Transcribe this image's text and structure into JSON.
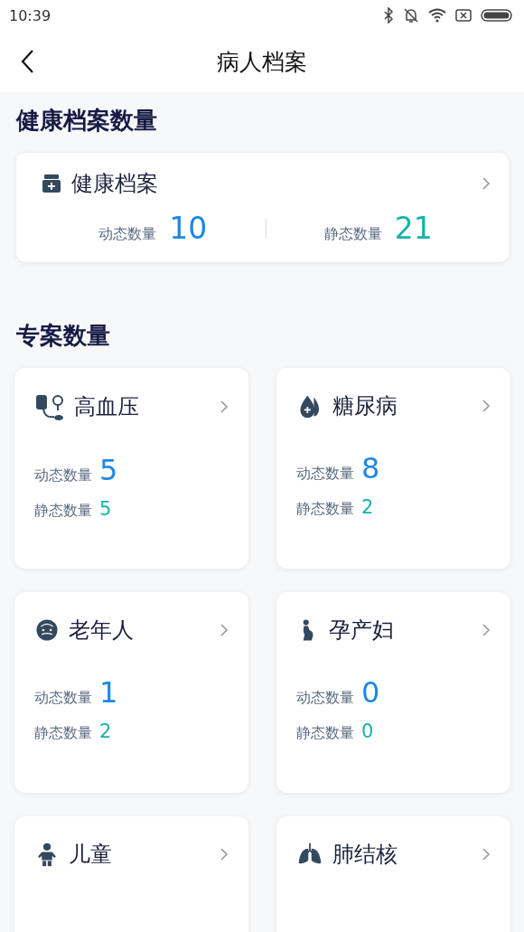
{
  "status_bar": {
    "time": "10:39"
  },
  "header": {
    "title": "病人档案"
  },
  "health_section": {
    "title": "健康档案数量",
    "card": {
      "title": "健康档案",
      "dynamic_label": "动态数量",
      "dynamic_count": "10",
      "static_label": "静态数量",
      "static_count": "21"
    }
  },
  "project_section": {
    "title": "专案数量",
    "cards": [
      {
        "kind": "blood-pressure",
        "title": "高血压",
        "dynamic_label": "动态数量",
        "dynamic_count": "5",
        "static_label": "静态数量",
        "static_count": "5"
      },
      {
        "kind": "diabetes",
        "title": "糖尿病",
        "dynamic_label": "动态数量",
        "dynamic_count": "8",
        "static_label": "静态数量",
        "static_count": "2"
      },
      {
        "kind": "elderly",
        "title": "老年人",
        "dynamic_label": "动态数量",
        "dynamic_count": "1",
        "static_label": "静态数量",
        "static_count": "2"
      },
      {
        "kind": "pregnant",
        "title": "孕产妇",
        "dynamic_label": "动态数量",
        "dynamic_count": "0",
        "static_label": "静态数量",
        "static_count": "0"
      },
      {
        "kind": "child",
        "title": "儿童"
      },
      {
        "kind": "lungs",
        "title": "肺结核"
      }
    ]
  }
}
